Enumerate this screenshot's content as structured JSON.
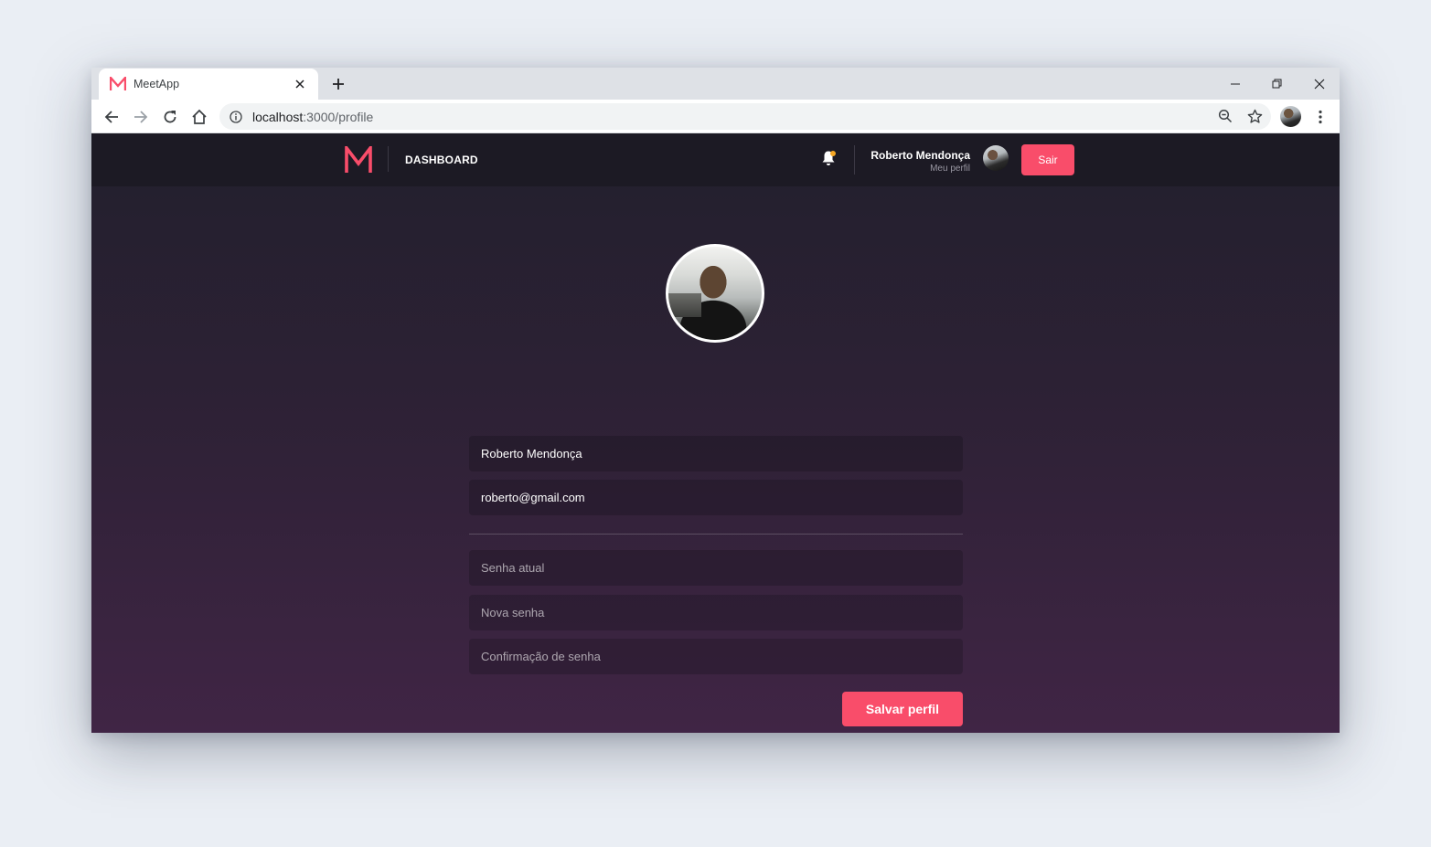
{
  "browser": {
    "tab_title": "MeetApp",
    "url_host": "localhost",
    "url_path": ":3000/profile"
  },
  "colors": {
    "brand": "#f94d6a",
    "header_bg": "#1c1a24",
    "notification_dot": "#f5a623"
  },
  "header": {
    "nav_dashboard": "DASHBOARD",
    "user_name": "Roberto Mendonça",
    "user_link": "Meu perfil",
    "logout_label": "Sair",
    "icons": [
      "meetapp-logo-icon",
      "bell-icon"
    ]
  },
  "profile_form": {
    "name_value": "Roberto Mendonça",
    "email_value": "roberto@gmail.com",
    "old_password_placeholder": "Senha atual",
    "new_password_placeholder": "Nova senha",
    "confirm_password_placeholder": "Confirmação de senha",
    "save_label": "Salvar perfil"
  }
}
